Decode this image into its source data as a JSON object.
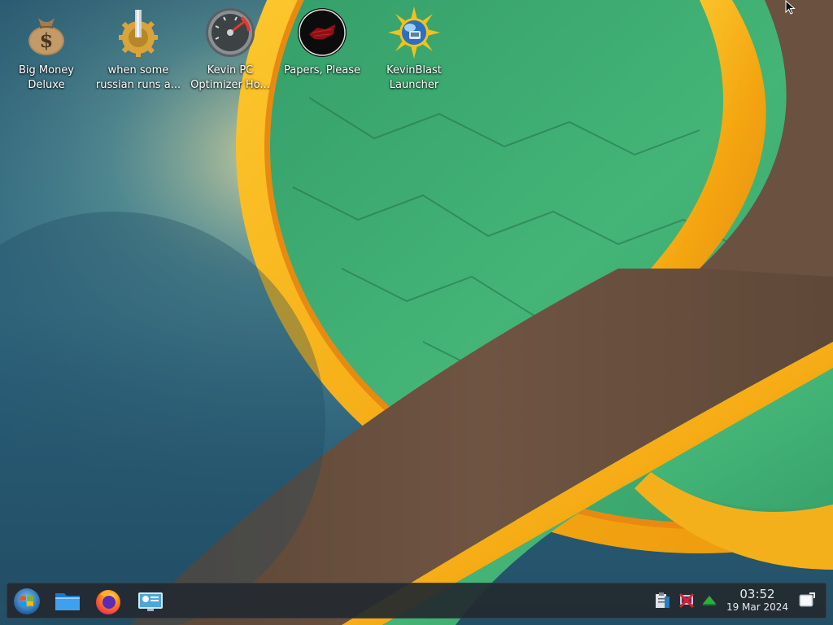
{
  "desktop": {
    "icons": [
      {
        "label": "Big Money\nDeluxe",
        "icon": "money-bag-icon"
      },
      {
        "label": "when some\nrussian runs a...",
        "icon": "gear-icon"
      },
      {
        "label": "Kevin PC\nOptimizer Ho...",
        "icon": "speedometer-icon"
      },
      {
        "label": "Papers, Please",
        "icon": "papers-please-icon"
      },
      {
        "label": "KevinBlast\nLauncher",
        "icon": "sun-globe-icon"
      }
    ]
  },
  "taskbar": {
    "launchers": [
      {
        "icon": "start-menu-icon"
      },
      {
        "icon": "file-manager-icon"
      },
      {
        "icon": "firefox-icon"
      },
      {
        "icon": "control-panel-icon"
      }
    ],
    "tray": [
      {
        "icon": "clipboard-icon"
      },
      {
        "icon": "network-disconnected-icon"
      },
      {
        "icon": "updates-arrow-icon"
      }
    ],
    "clock": {
      "time": "03:52",
      "date": "19 Mar 2024"
    },
    "show_desktop_icon": "show-desktop-icon"
  },
  "colors": {
    "wallpaper_blue": "#2d5c74",
    "wallpaper_green": "#3fae72",
    "wallpaper_gold": "#f6b514",
    "wallpaper_brown": "#6a5140",
    "taskbar_bg": "#242a30"
  }
}
